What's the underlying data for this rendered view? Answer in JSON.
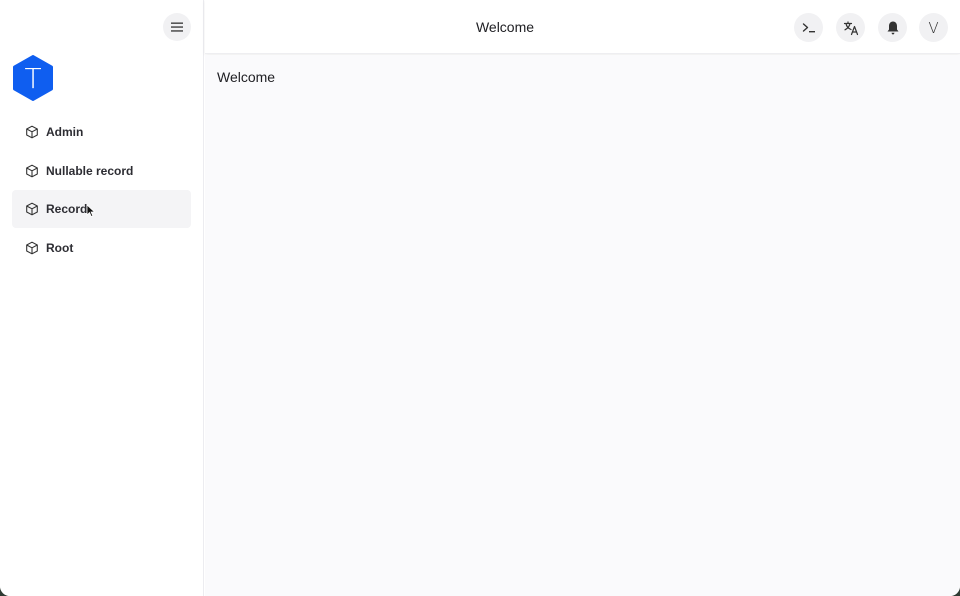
{
  "header": {
    "title": "Welcome",
    "buttons": [
      {
        "name": "terminal-icon"
      },
      {
        "name": "translate-icon"
      },
      {
        "name": "bell-icon"
      },
      {
        "name": "user-avatar",
        "label": "V"
      }
    ]
  },
  "sidebar": {
    "menu_icon": "hamburger-menu-icon",
    "logo": {
      "letter": "T",
      "color": "#0f5ef0"
    },
    "items": [
      {
        "label": "Admin",
        "icon": "cube-icon"
      },
      {
        "label": "Nullable record",
        "icon": "cube-icon"
      },
      {
        "label": "Record",
        "icon": "cube-icon",
        "hovered": true
      },
      {
        "label": "Root",
        "icon": "cube-icon"
      }
    ]
  },
  "main": {
    "text": "Welcome"
  }
}
